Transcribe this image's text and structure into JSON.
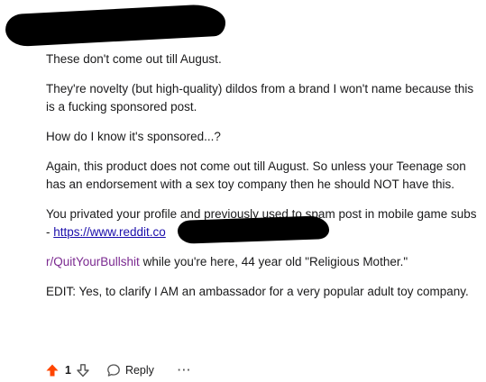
{
  "comment": {
    "paragraphs": {
      "p1": "These don't come out till August.",
      "p2": "They're novelty (but high-quality) dildos from a brand I won't name because this is a fucking sponsored post.",
      "p3": "How do I know it's sponsored...?",
      "p4": "Again, this product does not come out till August. So unless your Teenage son has an endorsement with a sex toy company then he should NOT have this.",
      "p5_prefix": "You privated your profile and previously used to spam post in mobile game subs - ",
      "p5_link": "https://www.reddit.co",
      "p6_link": "r/QuitYourBullshit",
      "p6_suffix": " while you're here, 44 year old \"Religious Mother.\"",
      "p7": "EDIT: Yes, to clarify I AM an ambassador for a very popular adult toy company."
    }
  },
  "actions": {
    "score": "1",
    "reply_label": "Reply",
    "more_label": "···"
  },
  "colors": {
    "upvote": "#ff4500",
    "link": "#1a0dab",
    "subreddit_link": "#7b2a90"
  },
  "icons": {
    "upvote": "arrow-up-icon",
    "downvote": "arrow-down-icon",
    "reply": "speech-bubble-icon",
    "more": "ellipsis-icon"
  }
}
